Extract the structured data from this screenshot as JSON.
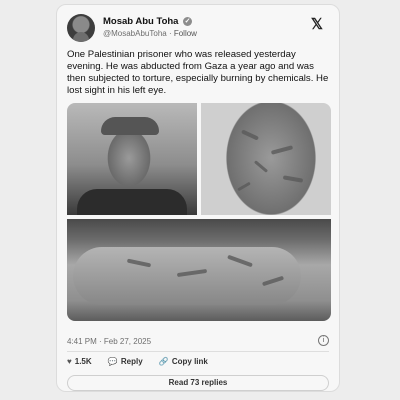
{
  "author": {
    "name": "Mosab Abu Toha",
    "handle": "@MosabAbuToha",
    "follow": "Follow"
  },
  "tweet": {
    "text": "One Palestinian prisoner who was released yesterday evening. He was abducted from Gaza a year ago and was then subjected to torture, especially burning by chemicals. He lost sight in his left eye.",
    "timestamp": "4:41 PM · Feb 27, 2025"
  },
  "actions": {
    "likes": "1.5K",
    "reply": "Reply",
    "copy_link": "Copy link"
  },
  "read_replies": "Read 73 replies",
  "icons": {
    "verified": "verified-badge-icon",
    "logo": "x-logo-icon",
    "info": "info-icon",
    "heart": "heart-icon",
    "reply": "reply-icon",
    "link": "link-icon"
  }
}
